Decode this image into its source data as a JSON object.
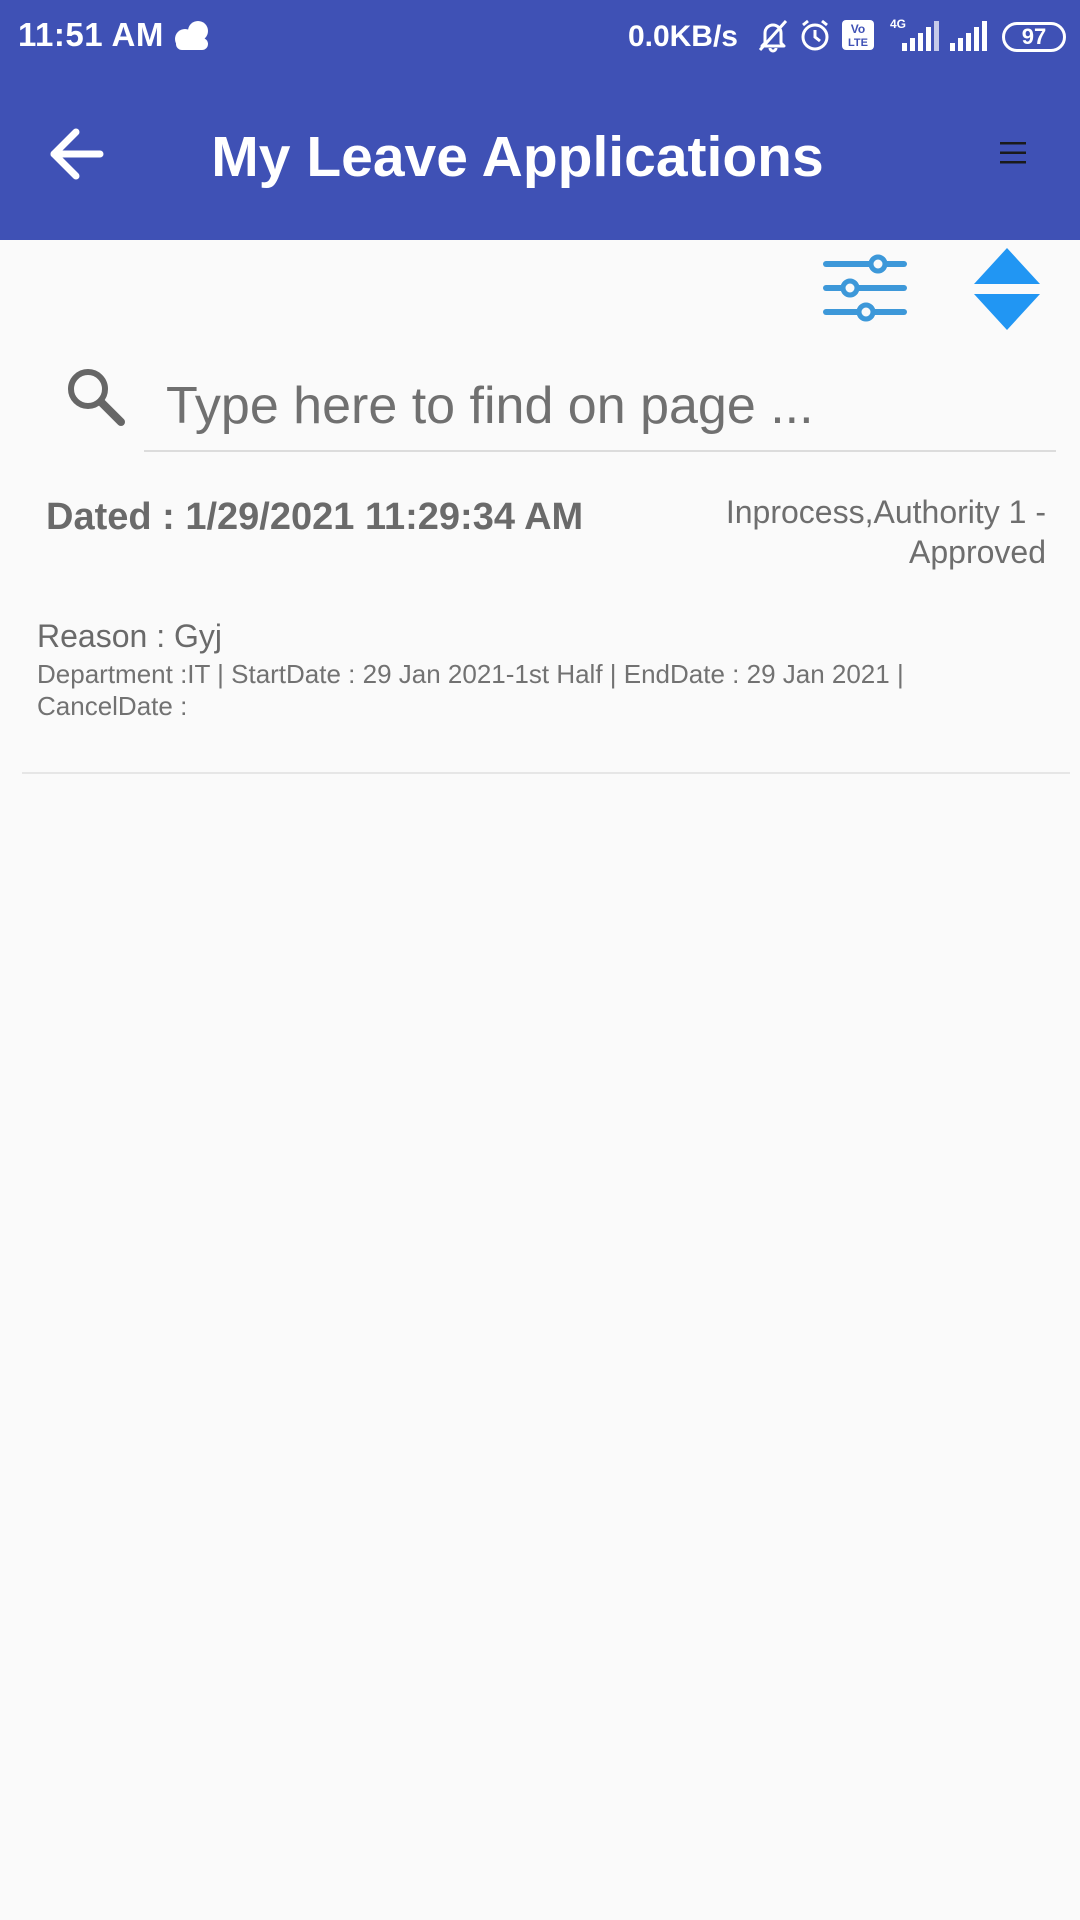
{
  "status_bar": {
    "time": "11:51 AM",
    "net_speed": "0.0KB/s",
    "network_type": "4G",
    "volte_label_top": "Vo",
    "volte_label_bottom": "LTE",
    "battery": "97",
    "icons": [
      "cloud-icon",
      "bell-off-icon",
      "alarm-icon",
      "volte-icon",
      "signal-icon",
      "signal-icon"
    ]
  },
  "toolbar": {
    "title": "My Leave Applications",
    "back_icon": "arrow-left-icon",
    "menu_icon": "hamburger-menu-icon"
  },
  "actions": {
    "filter_icon": "sliders-icon",
    "sort_icon": "sort-up-down-icon",
    "icon_color": "#2196f3"
  },
  "search": {
    "placeholder": "Type here to find on page ...",
    "value": "",
    "icon": "search-icon"
  },
  "applications": [
    {
      "dated": "Dated : 1/29/2021 11:29:34 AM",
      "status": "Inprocess,Authority 1 - Approved",
      "reason": "Reason : Gyj",
      "details": "Department :IT | StartDate : 29 Jan 2021-1st Half | EndDate : 29 Jan 2021 | CancelDate :"
    }
  ],
  "colors": {
    "primary": "#3f51b5",
    "accent": "#2196f3",
    "background": "#fafafa"
  }
}
